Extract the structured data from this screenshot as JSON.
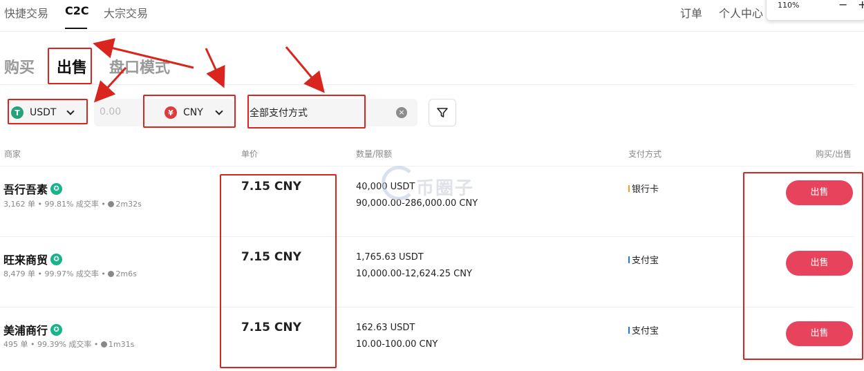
{
  "nav": {
    "tabs": [
      "快捷交易",
      "C2C",
      "大宗交易"
    ],
    "right_links": [
      "订单",
      "个人中心"
    ],
    "zoom": {
      "value": "110%",
      "minus": "−",
      "plus": "+"
    }
  },
  "modes": [
    "购买",
    "出售",
    "盘口模式"
  ],
  "filters": {
    "crypto": {
      "label": "USDT",
      "icon_glyph": "T",
      "color": "#26a17b"
    },
    "amount_placeholder": "0.00",
    "fiat": {
      "label": "CNY",
      "icon_glyph": "¥",
      "color": "#e03b3b"
    },
    "payment": "全部支付方式",
    "clear_glyph": "×"
  },
  "table": {
    "headers": [
      "商家",
      "单价",
      "数量/限额",
      "支付方式",
      "购买/出售"
    ],
    "rows": [
      {
        "name": "吾行吾素",
        "orders": "3,162 单",
        "rate": "99.81% 成交率",
        "time": "2m32s",
        "price": "7.15 CNY",
        "qty": "40,000 USDT",
        "limit": "90,000.00-286,000.00 CNY",
        "payment": "银行卡",
        "pay_color": "#f0a020",
        "action": "出售"
      },
      {
        "name": "旺来商贸",
        "orders": "8,479 单",
        "rate": "99.97% 成交率",
        "time": "2m6s",
        "price": "7.15 CNY",
        "qty": "1,765.63 USDT",
        "limit": "10,000.00-12,624.25 CNY",
        "payment": "支付宝",
        "pay_color": "#1677ff",
        "action": "出售"
      },
      {
        "name": "美浦商行",
        "orders": "495 单",
        "rate": "99.39% 成交率",
        "time": "1m31s",
        "price": "7.15 CNY",
        "qty": "162.63 USDT",
        "limit": "10.00-100.00 CNY",
        "payment": "支付宝",
        "pay_color": "#1677ff",
        "action": "出售"
      }
    ]
  },
  "watermark": "币圈子",
  "colors": {
    "accent": "#e8435c",
    "annotation": "#d9251d",
    "verified": "#17b38a"
  }
}
